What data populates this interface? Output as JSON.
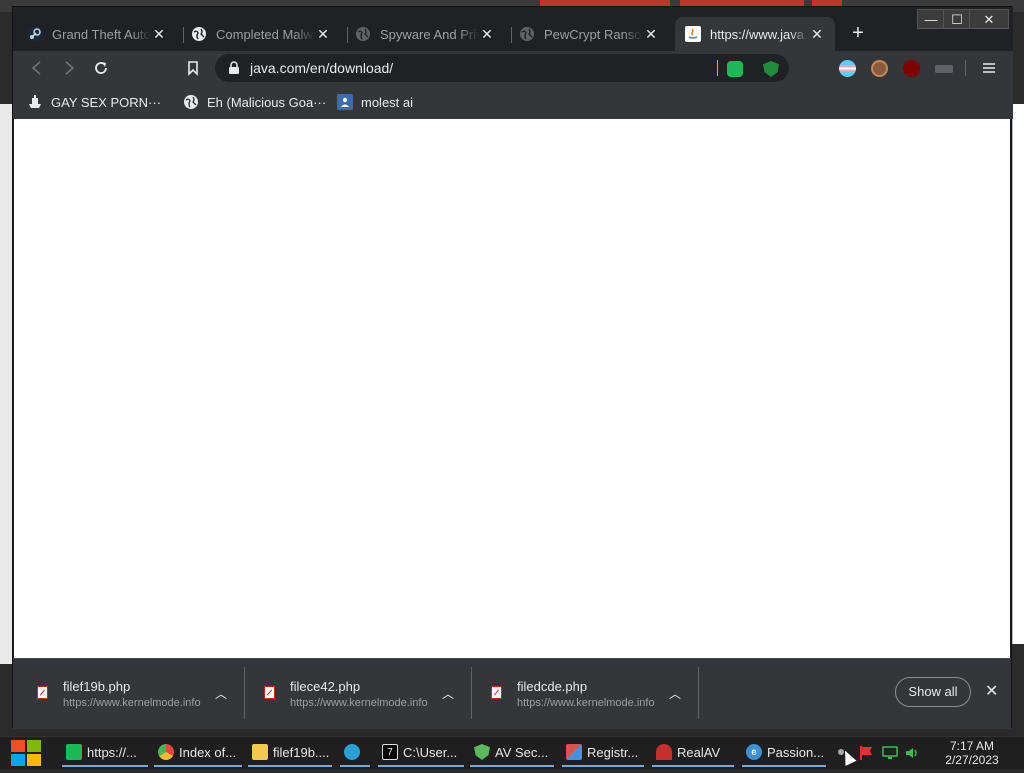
{
  "browser": {
    "tabs": [
      {
        "label": "Grand Theft Auto III",
        "icon": "steam-icon",
        "active": false
      },
      {
        "label": "Completed Malware",
        "icon": "globe-icon",
        "active": false
      },
      {
        "label": "Spyware And Privacy",
        "icon": "globe-icon",
        "active": false
      },
      {
        "label": "PewCrypt Ransomware",
        "icon": "globe-icon",
        "active": false
      },
      {
        "label": "https://www.java.com",
        "icon": "java-icon",
        "active": true
      }
    ],
    "new_tab_glyph": "+",
    "window_controls": {
      "minimize": "—",
      "maximize": "☐",
      "close": "✕"
    },
    "address": {
      "url": "java.com/en/download/"
    },
    "bookmarks": [
      {
        "label": "GAY SEX PORN···",
        "icon": "ship-icon"
      },
      {
        "label": "Eh (Malicious Goa···",
        "icon": "globe-icon"
      },
      {
        "label": "molest ai",
        "icon": "image-icon"
      }
    ]
  },
  "downloads": {
    "items": [
      {
        "filename": "filef19b.php",
        "source": "https://www.kernelmode.info"
      },
      {
        "filename": "filece42.php",
        "source": "https://www.kernelmode.info"
      },
      {
        "filename": "filedcde.php",
        "source": "https://www.kernelmode.info"
      }
    ],
    "show_all_label": "Show all",
    "close_glyph": "✕"
  },
  "taskbar": {
    "items": [
      {
        "label": "https://...",
        "icon": "chat-icon",
        "color": "#1db954"
      },
      {
        "label": "Index of...",
        "icon": "chrome-icon",
        "color": "#e8453c"
      },
      {
        "label": "filef19b....",
        "icon": "folder-icon",
        "color": "#f2c94c"
      },
      {
        "label": "",
        "icon": "edge-icon",
        "color": "#2a9fd6"
      },
      {
        "label": "C:\\User...",
        "icon": "7zip-icon",
        "color": "#dddddd"
      },
      {
        "label": "AV Sec...",
        "icon": "shield-icon",
        "color": "#5cb85c"
      },
      {
        "label": "Registr...",
        "icon": "registry-icon",
        "color": "#d9534f"
      },
      {
        "label": "RealAV",
        "icon": "realav-icon",
        "color": "#c9302c"
      },
      {
        "label": "Passion...",
        "icon": "ie-icon",
        "color": "#3a8fd6"
      }
    ],
    "clock": {
      "time": "7:17 AM",
      "date": "2/27/2023"
    }
  },
  "colors": {
    "frame": "#202124",
    "toolbar": "#35363a",
    "text": "#e8eaed",
    "muted": "#9aa0a6",
    "taskbar": "#1f1f1f"
  }
}
